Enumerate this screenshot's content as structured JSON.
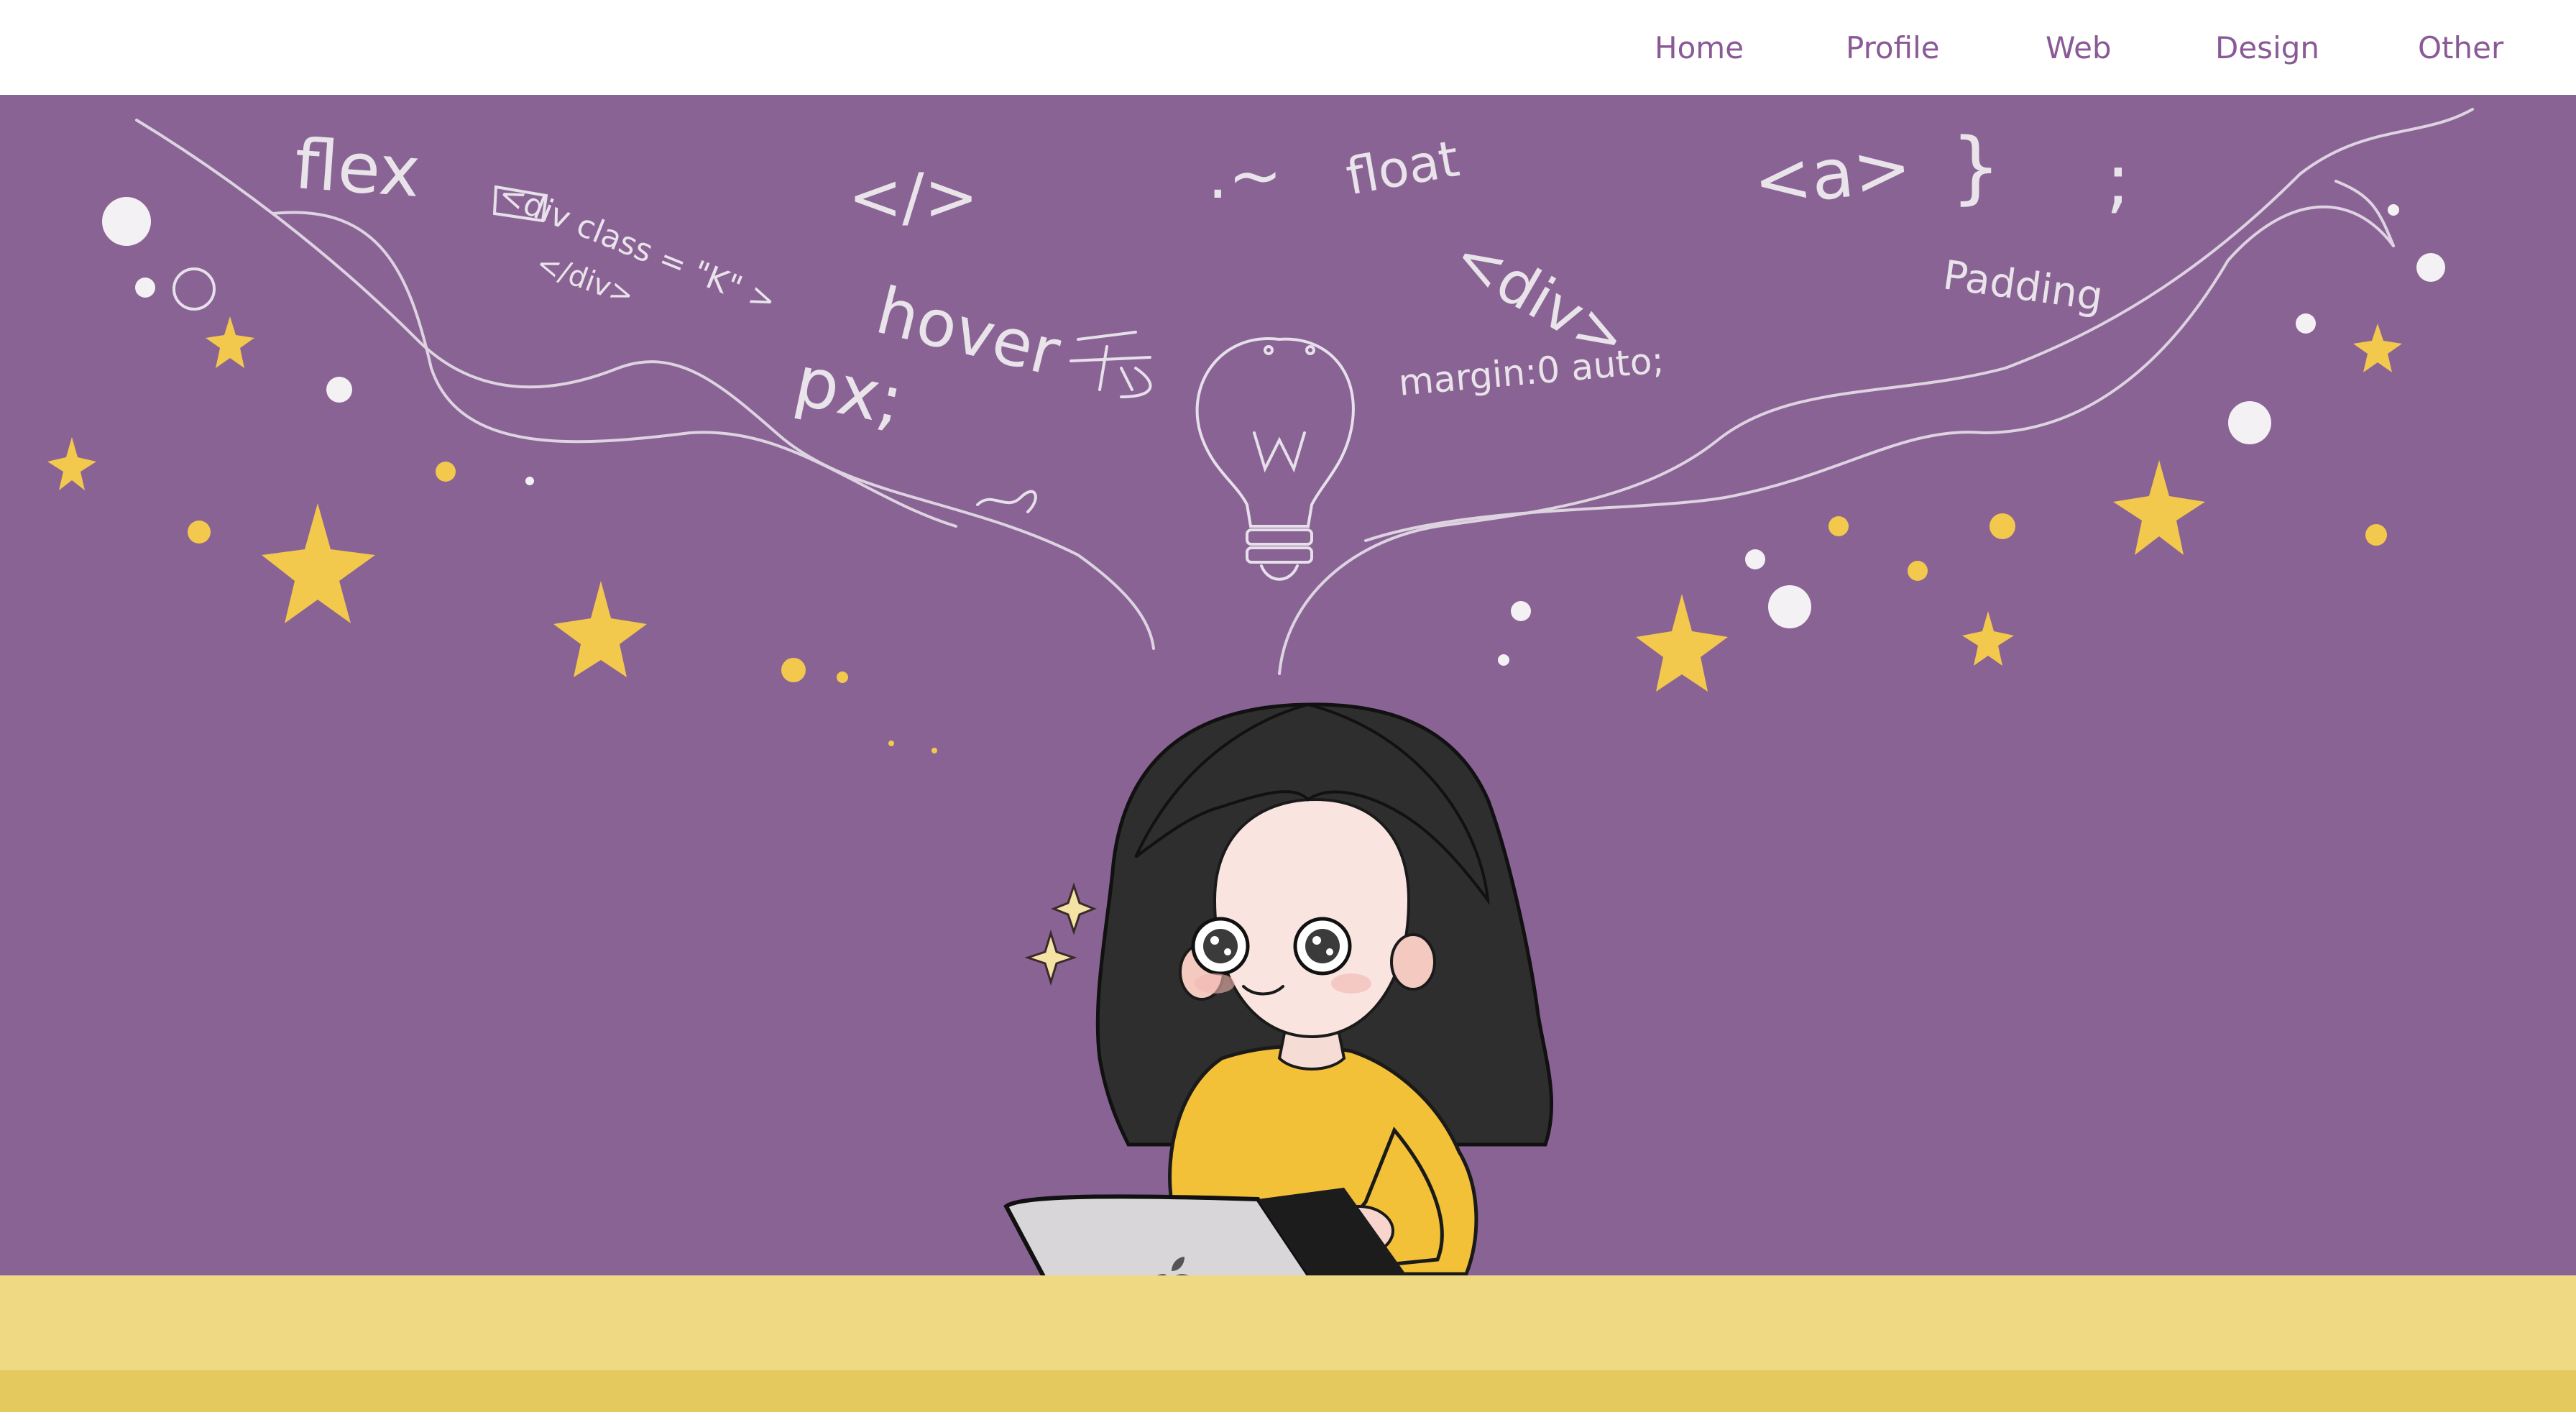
{
  "nav": {
    "items": [
      {
        "label": "Home"
      },
      {
        "label": "Profile"
      },
      {
        "label": "Web"
      },
      {
        "label": "Design"
      },
      {
        "label": "Other"
      }
    ]
  },
  "hero": {
    "chalk_words": {
      "flex": "flex",
      "div_class": "<div class = \"K\" >",
      "div_close": "</div>",
      "code_tag": "</>",
      "tilde": ".~",
      "float": "float",
      "div_tag": "<div>",
      "a_tag": "<a>",
      "brace": "}",
      "semicolon": ";",
      "hover": "hover",
      "px": "px;",
      "margin": "margin:0 auto;",
      "padding": "Padding"
    }
  },
  "colors": {
    "nav_text": "#8a5a96",
    "hero_bg": "#8a6395",
    "floor": "#efd983",
    "floor_edge": "#e4c95f",
    "chalk": "#e9e3ea",
    "star": "#f2c94c"
  }
}
